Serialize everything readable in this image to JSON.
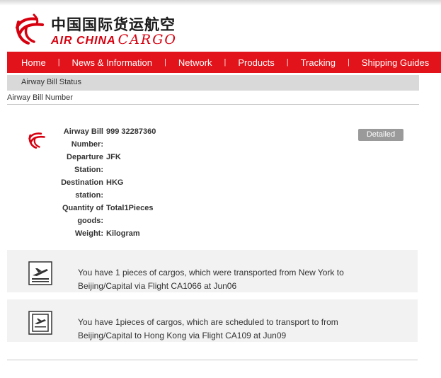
{
  "brand": {
    "name_cn": "中国国际货运航空",
    "name_en_a": "AIR CHINA",
    "name_en_b": "CARGO",
    "color": "#d7000f"
  },
  "nav": {
    "items": [
      {
        "label": "Home"
      },
      {
        "label": "News & Information"
      },
      {
        "label": "Network"
      },
      {
        "label": "Products"
      },
      {
        "label": "Tracking"
      },
      {
        "label": "Shipping Guides"
      }
    ],
    "separator": "|",
    "color": "#e2131a"
  },
  "tab": {
    "label": "Airway Bill Status"
  },
  "section": {
    "label": "Airway Bill Number"
  },
  "bill": {
    "rows": [
      {
        "label": "Airway Bill Number:",
        "value": "999 32287360"
      },
      {
        "label": "Departure Station:",
        "value": "JFK"
      },
      {
        "label": "Destination station:",
        "value": "HKG"
      },
      {
        "label": "Quantity of goods:",
        "value": "Total1Pieces"
      },
      {
        "label": "Weight:",
        "value": "Kilogram"
      }
    ],
    "detailed_button": "Detailed"
  },
  "routes": [
    {
      "icon": "departing-flight-icon",
      "text": "You have 1 pieces of cargos, which were transported from New York to Beijing/Capital via Flight CA1066 at Jun06"
    },
    {
      "icon": "scheduled-flight-icon",
      "text": "You have 1pieces of cargos, which are scheduled to transport to from Beijing/Capital to Hong Kong via Flight CA109 at Jun09"
    }
  ]
}
